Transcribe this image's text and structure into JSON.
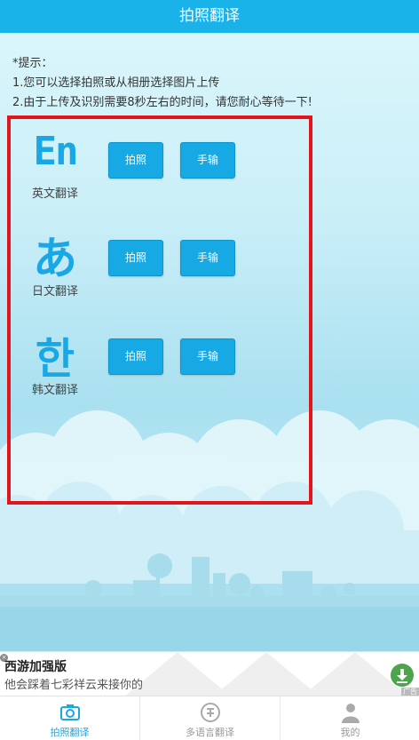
{
  "header": {
    "title": "拍照翻译"
  },
  "tips": {
    "line1": "*提示：",
    "line2": "1.您可以选择拍照或从相册选择图片上传",
    "line3": "2.由于上传及识别需要8秒左右的时间，请您耐心等待一下!"
  },
  "rows": [
    {
      "glyph": "En",
      "label": "英文翻译",
      "photo_label": "拍照",
      "hand_label": "手输"
    },
    {
      "glyph": "あ",
      "label": "日文翻译",
      "photo_label": "拍照",
      "hand_label": "手输"
    },
    {
      "glyph": "한",
      "label": "韩文翻译",
      "photo_label": "拍照",
      "hand_label": "手输"
    }
  ],
  "ad": {
    "title": "西游加强版",
    "subtitle": "他会踩着七彩祥云来接你的",
    "close_glyph": "×",
    "tag": "广告"
  },
  "tabs": [
    {
      "label": "拍照翻译",
      "icon": "camera-icon",
      "active": true
    },
    {
      "label": "多语言翻译",
      "icon": "translate-icon",
      "active": false
    },
    {
      "label": "我的",
      "icon": "user-icon",
      "active": false
    }
  ],
  "colors": {
    "header": "#19b3ea",
    "accent": "#1aa7e6",
    "highlight_frame": "#e0161c",
    "tab_active": "#1aa7e6",
    "tab_inactive": "#999999"
  }
}
